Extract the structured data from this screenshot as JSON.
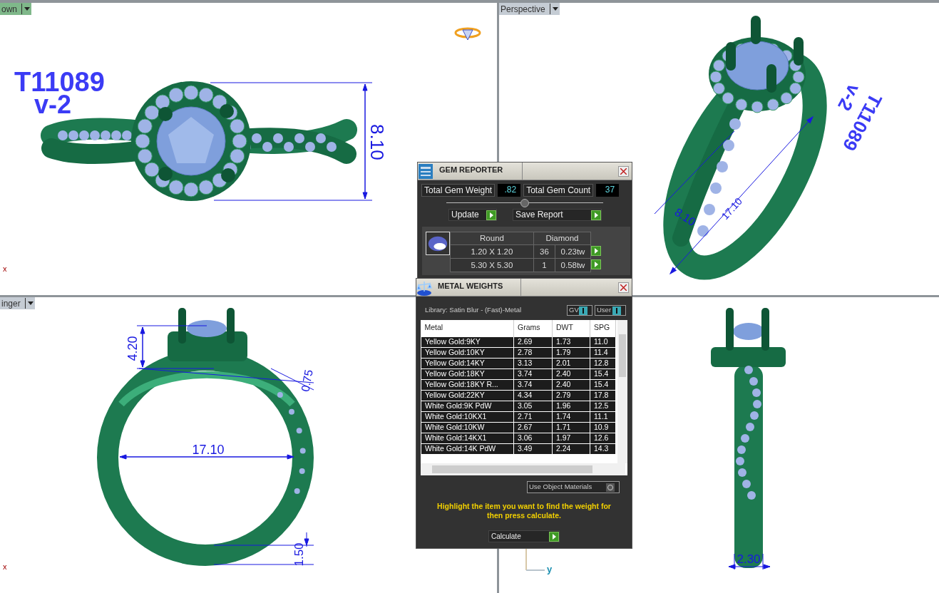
{
  "viewports": [
    {
      "label": "own",
      "selected": true,
      "corner_mark": "x",
      "annotations": [
        {
          "kind": "title",
          "text": "T11089"
        },
        {
          "kind": "title",
          "text": "v-2"
        },
        {
          "kind": "dimension",
          "text": "8.10"
        }
      ]
    },
    {
      "label": "Perspective",
      "selected": false,
      "annotations": [
        {
          "kind": "dimension",
          "text": "17.10"
        },
        {
          "kind": "dimension",
          "text": "8.10"
        },
        {
          "kind": "title",
          "text": "T11089"
        },
        {
          "kind": "title",
          "text": "v-2"
        }
      ]
    },
    {
      "label": "inger",
      "selected": false,
      "corner_mark": "x",
      "annotations": [
        {
          "kind": "dimension",
          "text": "4.20"
        },
        {
          "kind": "dimension",
          "text": "0.75"
        },
        {
          "kind": "dimension",
          "text": "17.10"
        },
        {
          "kind": "dimension",
          "text": "1.50"
        }
      ]
    },
    {
      "annotations": [
        {
          "kind": "dimension",
          "text": "2.30"
        },
        {
          "kind": "axis",
          "text": "y"
        }
      ]
    }
  ],
  "gem_reporter": {
    "title": "GEM REPORTER",
    "stats": [
      {
        "label": "Total Gem Weight",
        "value": ".82"
      },
      {
        "label": "Total Gem Count",
        "value": "37"
      }
    ],
    "buttons": [
      "Update",
      "Save Report"
    ],
    "table": {
      "columns": [
        "Round",
        "Diamond"
      ],
      "rows": [
        {
          "size": "1.20 X 1.20",
          "count": "36",
          "weight": "0.23tw"
        },
        {
          "size": "5.30 X 5.30",
          "count": "1",
          "weight": "0.58tw"
        }
      ]
    }
  },
  "metal_weights": {
    "title": "METAL WEIGHTS",
    "library": "Library: Satin Blur - (Fast)-Metal",
    "toggles": [
      {
        "label": "GV",
        "on": true
      },
      {
        "label": "User",
        "on": true
      }
    ],
    "table": {
      "columns": [
        "Metal",
        "Grams",
        "DWT",
        "SPG"
      ],
      "rows": [
        [
          "Yellow Gold:9KY",
          "2.69",
          "1.73",
          "11.0"
        ],
        [
          "Yellow Gold:10KY",
          "2.78",
          "1.79",
          "11.4"
        ],
        [
          "Yellow Gold:14KY",
          "3.13",
          "2.01",
          "12.8"
        ],
        [
          "Yellow Gold:18KY",
          "3.74",
          "2.40",
          "15.4"
        ],
        [
          "Yellow Gold:18KY R...",
          "3.74",
          "2.40",
          "15.4"
        ],
        [
          "Yellow Gold:22KY",
          "4.34",
          "2.79",
          "17.8"
        ],
        [
          "White Gold:9K PdW",
          "3.05",
          "1.96",
          "12.5"
        ],
        [
          "White Gold:10KX1",
          "2.71",
          "1.74",
          "11.1"
        ],
        [
          "White Gold:10KW",
          "2.67",
          "1.71",
          "10.9"
        ],
        [
          "White Gold:14KX1",
          "3.06",
          "1.97",
          "12.6"
        ],
        [
          "White Gold:14K PdW",
          "3.49",
          "2.24",
          "14.3"
        ]
      ]
    },
    "options": [
      {
        "label": "Use Object Materials",
        "on": false
      }
    ],
    "hint": "Highlight the item you want to find the weight for then press calculate.",
    "button": "Calculate"
  }
}
